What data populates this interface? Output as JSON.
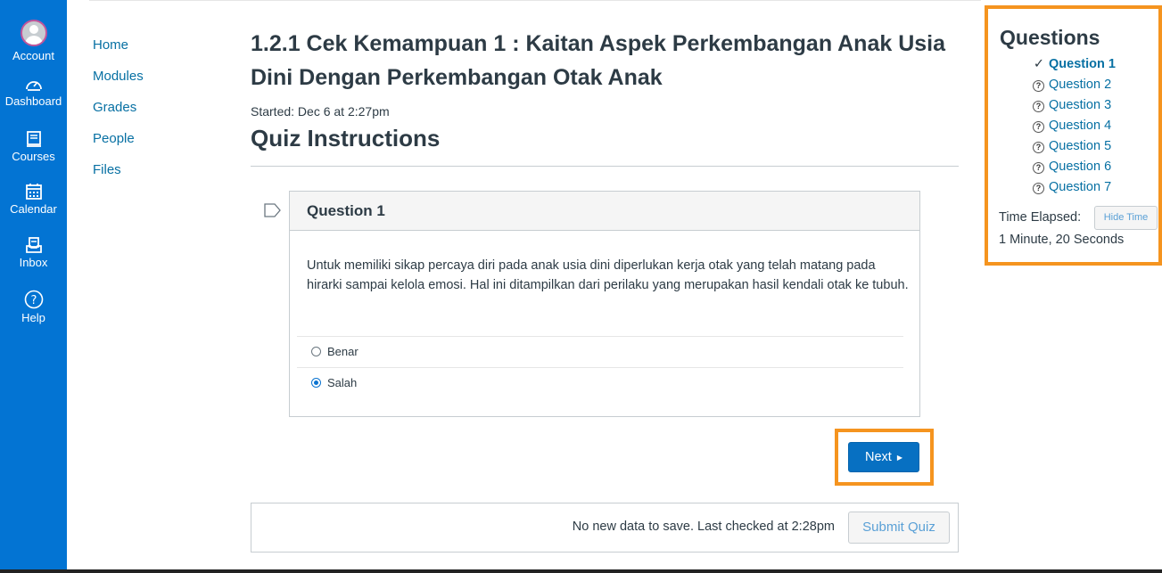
{
  "global_nav": {
    "account": "Account",
    "dashboard": "Dashboard",
    "courses": "Courses",
    "calendar": "Calendar",
    "inbox": "Inbox",
    "help": "Help"
  },
  "course_nav": {
    "items": [
      "Home",
      "Modules",
      "Grades",
      "People",
      "Files"
    ]
  },
  "quiz": {
    "title": "1.2.1 Cek Kemampuan 1 : Kaitan Aspek Perkembangan Anak Usia Dini Dengan Perkembangan Otak Anak",
    "started": "Started: Dec 6 at 2:27pm",
    "instructions_heading": "Quiz Instructions"
  },
  "question": {
    "header": "Question 1",
    "text": "Untuk memiliki sikap percaya diri pada anak usia dini diperlukan kerja otak yang telah matang pada hirarki sampai kelola emosi. Hal ini ditampilkan dari perilaku yang merupakan hasil kendali otak ke tubuh.",
    "answers": [
      {
        "label": "Benar",
        "selected": false
      },
      {
        "label": "Salah",
        "selected": true
      }
    ]
  },
  "actions": {
    "next_label": "Next",
    "save_message": "No new data to save. Last checked at 2:28pm",
    "submit_label": "Submit Quiz"
  },
  "sidebar": {
    "title": "Questions",
    "questions": [
      {
        "label": "Question 1",
        "status": "answered",
        "current": true
      },
      {
        "label": "Question 2",
        "status": "unanswered",
        "current": false
      },
      {
        "label": "Question 3",
        "status": "unanswered",
        "current": false
      },
      {
        "label": "Question 4",
        "status": "unanswered",
        "current": false
      },
      {
        "label": "Question 5",
        "status": "unanswered",
        "current": false
      },
      {
        "label": "Question 6",
        "status": "unanswered",
        "current": false
      },
      {
        "label": "Question 7",
        "status": "unanswered",
        "current": false
      }
    ],
    "time_elapsed_label": "Time Elapsed:",
    "hide_time_label": "Hide Time",
    "time_elapsed_value": "1 Minute, 20 Seconds"
  },
  "colors": {
    "nav_bg": "#0374d3",
    "link": "#0770a3",
    "highlight": "#f5941f",
    "primary_button": "#0770c2"
  }
}
